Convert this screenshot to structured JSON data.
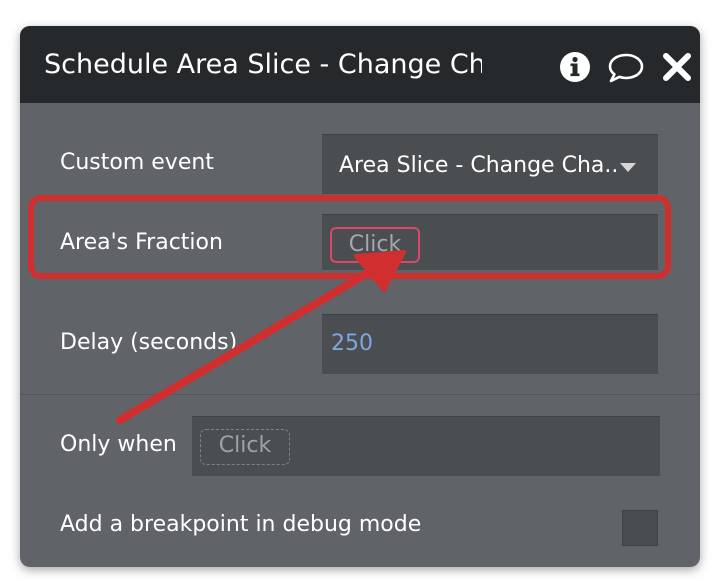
{
  "dialog": {
    "title": "Schedule Area Slice - Change Chart",
    "icons": {
      "info": "info-icon",
      "comment": "comment-icon",
      "close": "close-icon"
    }
  },
  "fields": {
    "custom_event": {
      "label": "Custom event",
      "value": "Area Slice - Change Cha..."
    },
    "areas_fraction": {
      "label": "Area's Fraction",
      "placeholder": "Click"
    },
    "delay": {
      "label": "Delay (seconds)",
      "value": "250"
    },
    "only_when": {
      "label": "Only when",
      "placeholder": "Click"
    },
    "breakpoint": {
      "label": "Add a breakpoint in debug mode",
      "checked": false
    }
  },
  "colors": {
    "panel_bg": "#606468",
    "header_bg": "#26292b",
    "field_bg": "#4b4e51",
    "value_blue": "#7fa6df",
    "annotation_red": "#d12f2f"
  }
}
